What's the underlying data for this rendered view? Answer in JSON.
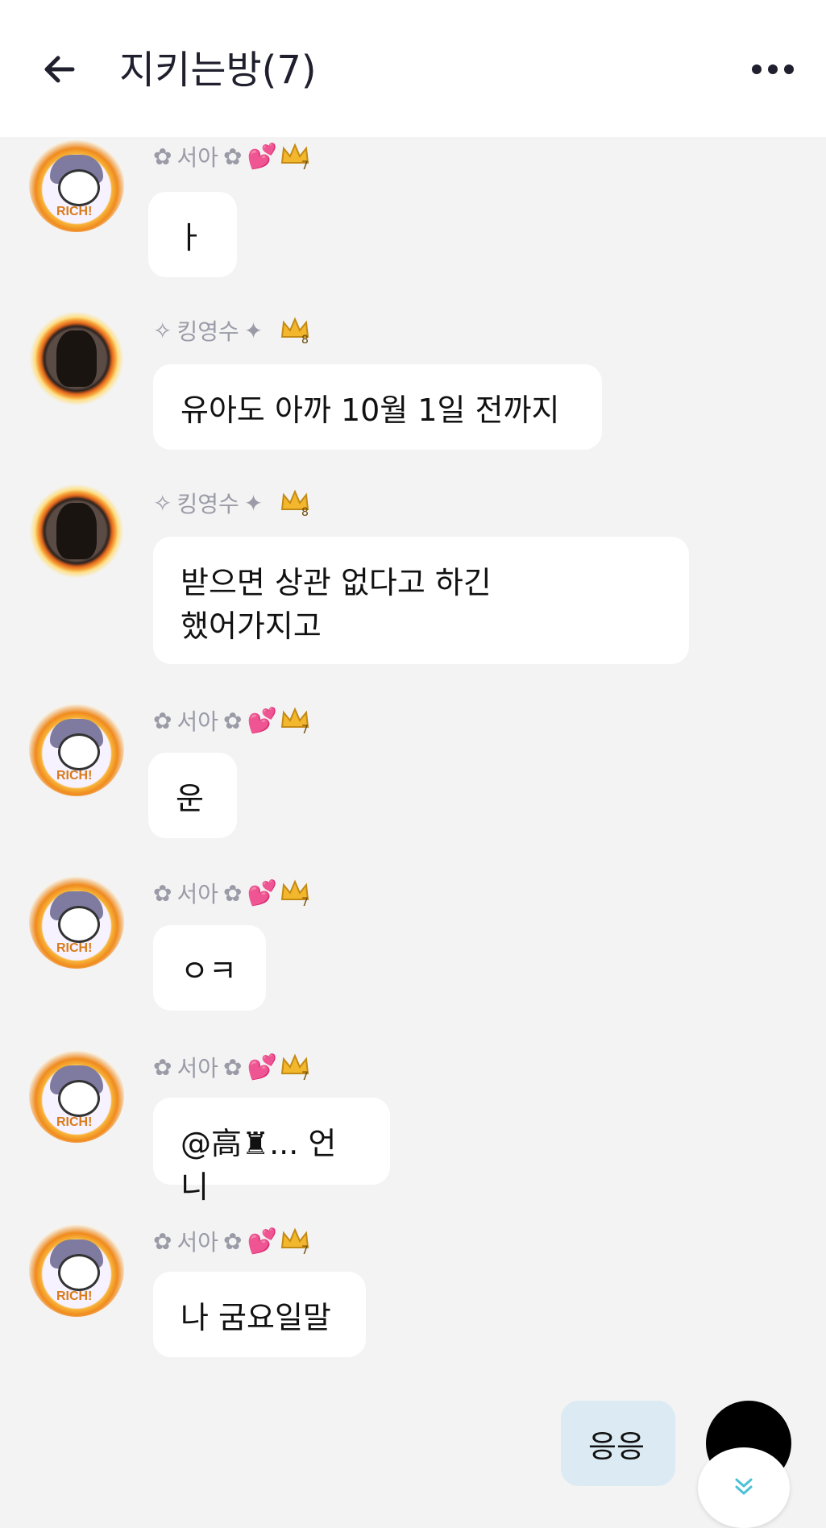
{
  "header": {
    "title": "지키는방(7)",
    "back_icon": "arrow-left-icon",
    "more_icon": "more-dots-icon"
  },
  "colors": {
    "header_bg": "#ffffff",
    "chat_bg": "#f3f3f3",
    "bubble_in": "#ffffff",
    "bubble_out": "#dcebf3",
    "nickname": "#9b9ba8",
    "heart": "#ff3fa3",
    "crown": "#f2b72c"
  },
  "messages": [
    {
      "sender": "서아",
      "crown_level": "7",
      "text": "ㅏ"
    },
    {
      "sender": "킹영수",
      "crown_level": "8",
      "text": "유아도 아까 10월 1일 전까지"
    },
    {
      "sender": "킹영수",
      "crown_level": "8",
      "text_line1": "받으면 상관 없다고 하긴",
      "text_line2": "했어가지고"
    },
    {
      "sender": "서아",
      "crown_level": "7",
      "text": "운"
    },
    {
      "sender": "서아",
      "crown_level": "7",
      "text": "ㅇㅋ"
    },
    {
      "sender": "서아",
      "crown_level": "7",
      "text": "@高♜... 언니"
    },
    {
      "sender": "서아",
      "crown_level": "7",
      "text": "나 굼요일말"
    }
  ],
  "outgoing": {
    "text": "응응"
  },
  "scroll_down_icon": "double-chevron-down-icon"
}
